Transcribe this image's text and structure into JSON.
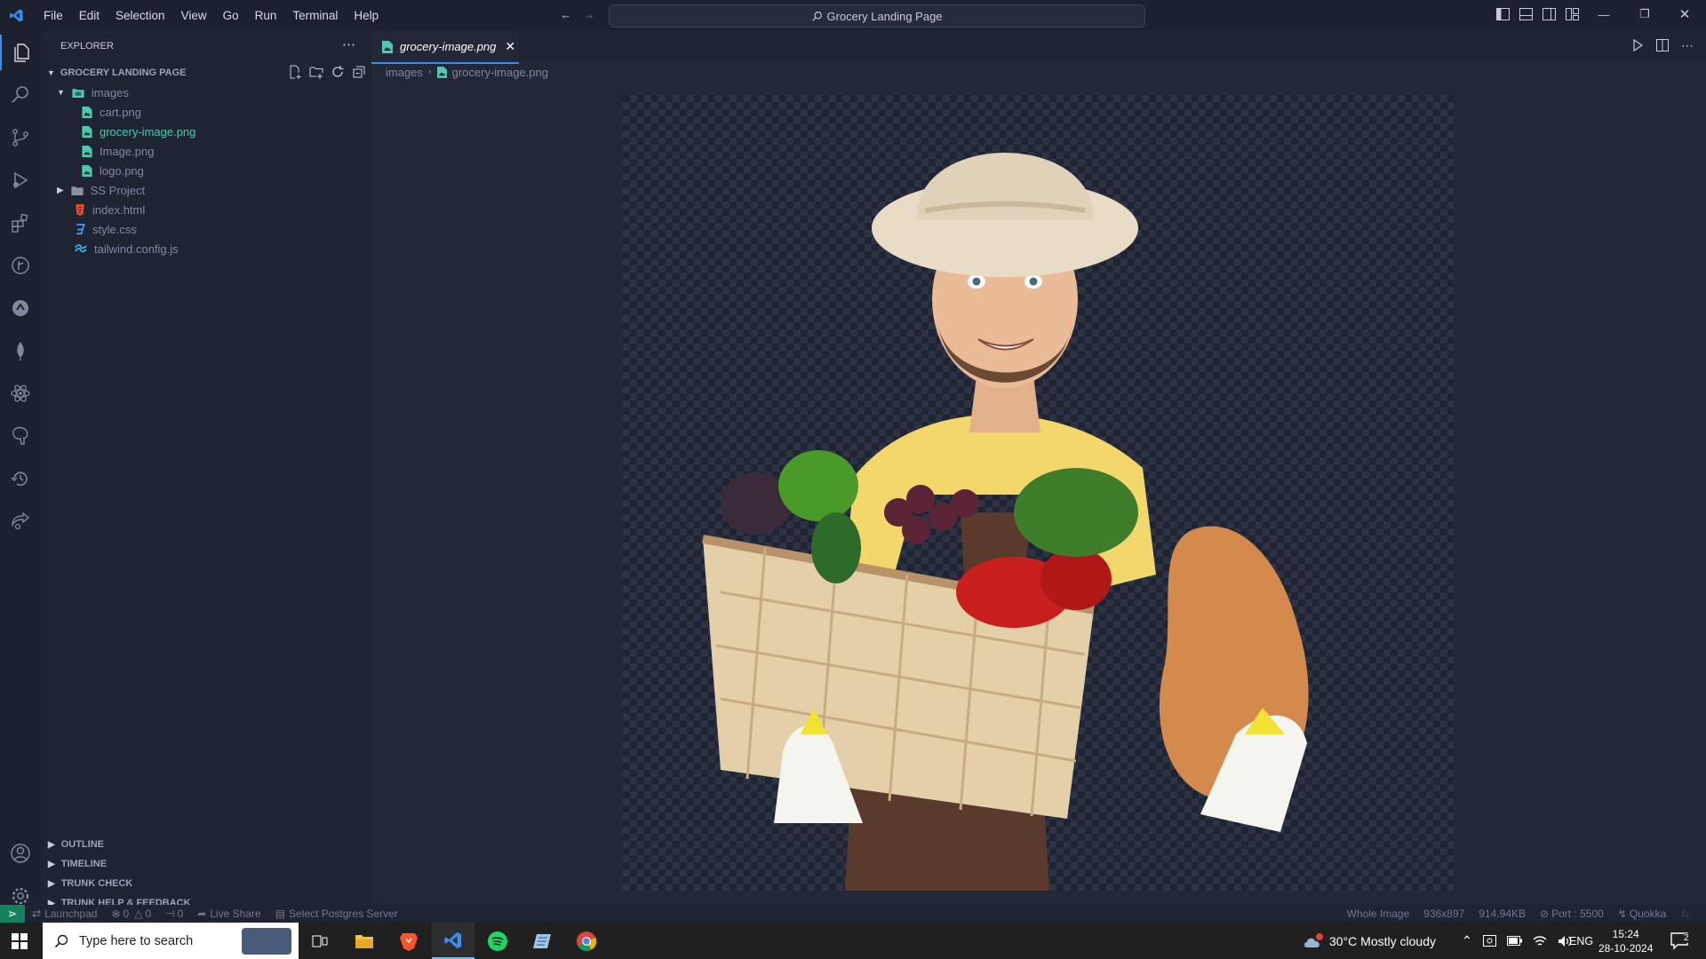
{
  "titlebar": {
    "menu": [
      "File",
      "Edit",
      "Selection",
      "View",
      "Go",
      "Run",
      "Terminal",
      "Help"
    ],
    "search_text": "Grocery Landing Page"
  },
  "sidebar": {
    "header": "EXPLORER",
    "project": "GROCERY LANDING PAGE",
    "tree": [
      {
        "label": "images",
        "type": "folder-open",
        "level": 1
      },
      {
        "label": "cart.png",
        "type": "image",
        "level": 2
      },
      {
        "label": "grocery-image.png",
        "type": "image",
        "level": 2,
        "selected": true
      },
      {
        "label": "Image.png",
        "type": "image",
        "level": 2
      },
      {
        "label": "logo.png",
        "type": "image",
        "level": 2
      },
      {
        "label": "SS Project",
        "type": "folder",
        "level": 1
      },
      {
        "label": "index.html",
        "type": "html",
        "level": 1
      },
      {
        "label": "style.css",
        "type": "css",
        "level": 1
      },
      {
        "label": "tailwind.config.js",
        "type": "tailwind",
        "level": 1
      }
    ],
    "sections": [
      "OUTLINE",
      "TIMELINE",
      "TRUNK CHECK",
      "TRUNK HELP & FEEDBACK"
    ]
  },
  "editor": {
    "tab_label": "grocery-image.png",
    "breadcrumb": [
      "images",
      "grocery-image.png"
    ]
  },
  "statusbar": {
    "launchpad": "Launchpad",
    "problems": "0",
    "warnings": "0",
    "ports": "0",
    "liveshare": "Live Share",
    "postgres": "Select Postgres Server",
    "image_mode": "Whole Image",
    "dimensions": "936x897",
    "filesize": "914.94KB",
    "port": "Port : 5500",
    "quokka": "Quokka"
  },
  "taskbar": {
    "search_placeholder": "Type here to search",
    "weather": "30°C  Mostly cloudy",
    "lang": "ENG",
    "time": "15:24",
    "date": "28-10-2024",
    "notification_count": "2"
  },
  "colors": {
    "accent": "#3b8eea",
    "sidebar_bg": "#1f2433",
    "editor_bg": "#222838",
    "image_file": "#4ec9b0"
  }
}
